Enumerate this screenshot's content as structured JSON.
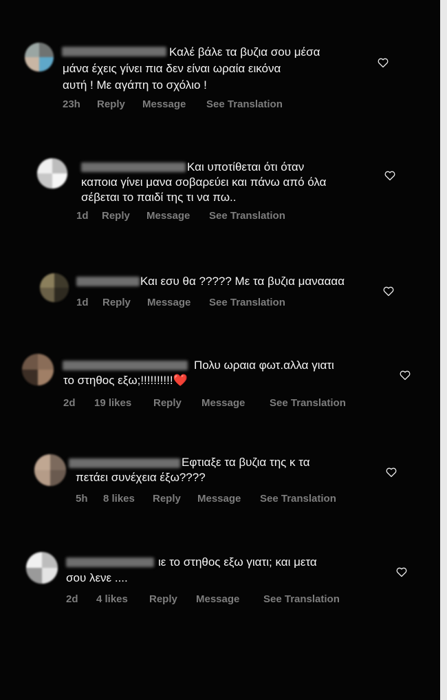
{
  "comments": [
    {
      "line1": "Καλέ βάλε τα βυζια σου μέσα",
      "line2": "μάνα έχεις γίνει πια δεν είναι ωραία εικόνα",
      "line3": "αυτή ! Με αγάπη το σχόλιο !",
      "time": "23h",
      "likes": "",
      "reply": "Reply",
      "message": "Message",
      "translation": "See Translation"
    },
    {
      "line1": "Και υποτίθεται ότι όταν",
      "line2": "καποια γίνει μανα σοβαρεύει και πάνω από όλα",
      "line3": "σέβεται το παιδί της τι να πω..",
      "time": "1d",
      "likes": "",
      "reply": "Reply",
      "message": "Message",
      "translation": "See Translation"
    },
    {
      "line1": "Και εσυ θα ????? Με τα βυζια μαναααα",
      "time": "1d",
      "likes": "",
      "reply": "Reply",
      "message": "Message",
      "translation": "See Translation"
    },
    {
      "line1": "Πολυ ωραια φωτ.αλλα γιατι",
      "line2": "το στηθος εξω;!!!!!!!!!!",
      "emoji": "❤️",
      "time": "2d",
      "likes": "19 likes",
      "reply": "Reply",
      "message": "Message",
      "translation": "See Translation"
    },
    {
      "line1": "Εφτιαξε τα βυζια της κ τα",
      "line2": "πετάει συνέχεια έξω????",
      "time": "5h",
      "likes": "8 likes",
      "reply": "Reply",
      "message": "Message",
      "translation": "See Translation"
    },
    {
      "line1": "ιε το στηθος εξω γιατι; και μετα",
      "line2": "σου λενε ....",
      "time": "2d",
      "likes": "4 likes",
      "reply": "Reply",
      "message": "Message",
      "translation": "See Translation"
    }
  ],
  "icons": {
    "heart": "heart-outline-icon",
    "emoji": "red-heart-emoji"
  },
  "colors": {
    "background": "#050505",
    "text": "#f5f5f5",
    "meta": "#7d7d7d"
  }
}
